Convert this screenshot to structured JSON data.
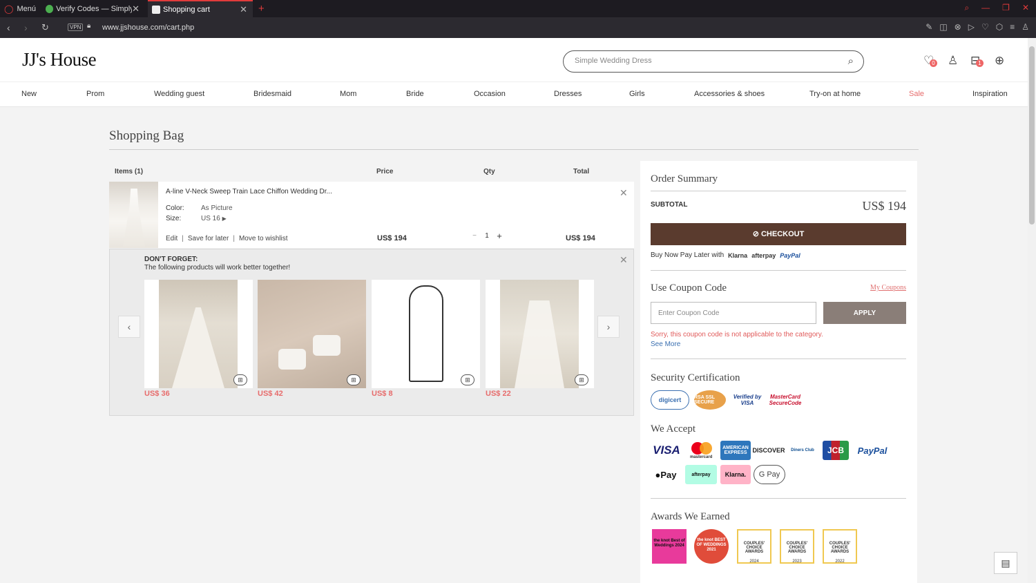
{
  "browser": {
    "menu_label": "Menú",
    "tabs": [
      {
        "title": "Verify Codes — SimplyCod"
      },
      {
        "title": "Shopping cart"
      }
    ],
    "vpn_label": "VPN",
    "url": "www.jjshouse.com/cart.php"
  },
  "site": {
    "logo": "JJ's House",
    "search_placeholder": "Simple Wedding Dress",
    "wishlist_count": "0",
    "bag_count": "1",
    "nav": [
      "New",
      "Prom",
      "Wedding guest",
      "Bridesmaid",
      "Mom",
      "Bride",
      "Occasion",
      "Dresses",
      "Girls",
      "Accessories & shoes",
      "Try-on at home",
      "Sale",
      "Inspiration"
    ],
    "sale_color": "#e76c6c"
  },
  "cart": {
    "title": "Shopping Bag",
    "columns": {
      "items": "Items (1)",
      "price": "Price",
      "qty": "Qty",
      "total": "Total"
    },
    "item": {
      "name": "A-line V-Neck Sweep Train Lace Chiffon Wedding Dr...",
      "color_label": "Color:",
      "color_value": "As Picture",
      "size_label": "Size:",
      "size_value": "US 16",
      "edit": "Edit",
      "save_for_later": "Save for later",
      "move_to_wishlist": "Move to wishlist",
      "price": "US$ 194",
      "qty": "1",
      "total": "US$ 194"
    },
    "dont_forget": {
      "title": "DON'T FORGET:",
      "subtitle": "The following products will work better together!",
      "products": [
        {
          "price": "US$ 36",
          "icon": "veil-image"
        },
        {
          "price": "US$ 42",
          "icon": "sandals-image"
        },
        {
          "price": "US$ 8",
          "icon": "garment-bag-image"
        },
        {
          "price": "US$ 22",
          "icon": "veil-back-image"
        }
      ]
    }
  },
  "summary": {
    "title": "Order Summary",
    "subtotal_label": "SUBTOTAL",
    "subtotal_value": "US$ 194",
    "checkout_label": "CHECKOUT",
    "bnpl_text": "Buy Now Pay Later with",
    "bnpl_klarna": "Klarna",
    "bnpl_afterpay": "afterpay",
    "bnpl_paypal": "PayPal",
    "coupon_title": "Use Coupon Code",
    "my_coupons": "My Coupons",
    "coupon_placeholder": "Enter Coupon Code",
    "apply_label": "APPLY",
    "coupon_error": "Sorry, this coupon code is not applicable to the category.",
    "see_more": "See More",
    "security_title": "Security Certification",
    "security_logos": [
      "digicert",
      "RSA SSL SECURE",
      "Verified by VISA",
      "MasterCard SecureCode"
    ],
    "accept_title": "We Accept",
    "payments_row1": [
      "VISA",
      "mastercard",
      "AMERICAN EXPRESS",
      "DISCOVER",
      "Diners Club",
      "JCB",
      "PayPal"
    ],
    "payments_row2": [
      "Pay",
      "afterpay",
      "Klarna.",
      "G Pay"
    ],
    "awards_title": "Awards We Earned",
    "awards": [
      {
        "text": "the knot Best of Weddings 2024"
      },
      {
        "text": "the knot BEST OF WEDDINGS 2021"
      },
      {
        "text": "COUPLES' CHOICE AWARDS",
        "year": "2024"
      },
      {
        "text": "COUPLES' CHOICE AWARDS",
        "year": "2023"
      },
      {
        "text": "COUPLES' CHOICE AWARDS",
        "year": "2022"
      }
    ]
  }
}
